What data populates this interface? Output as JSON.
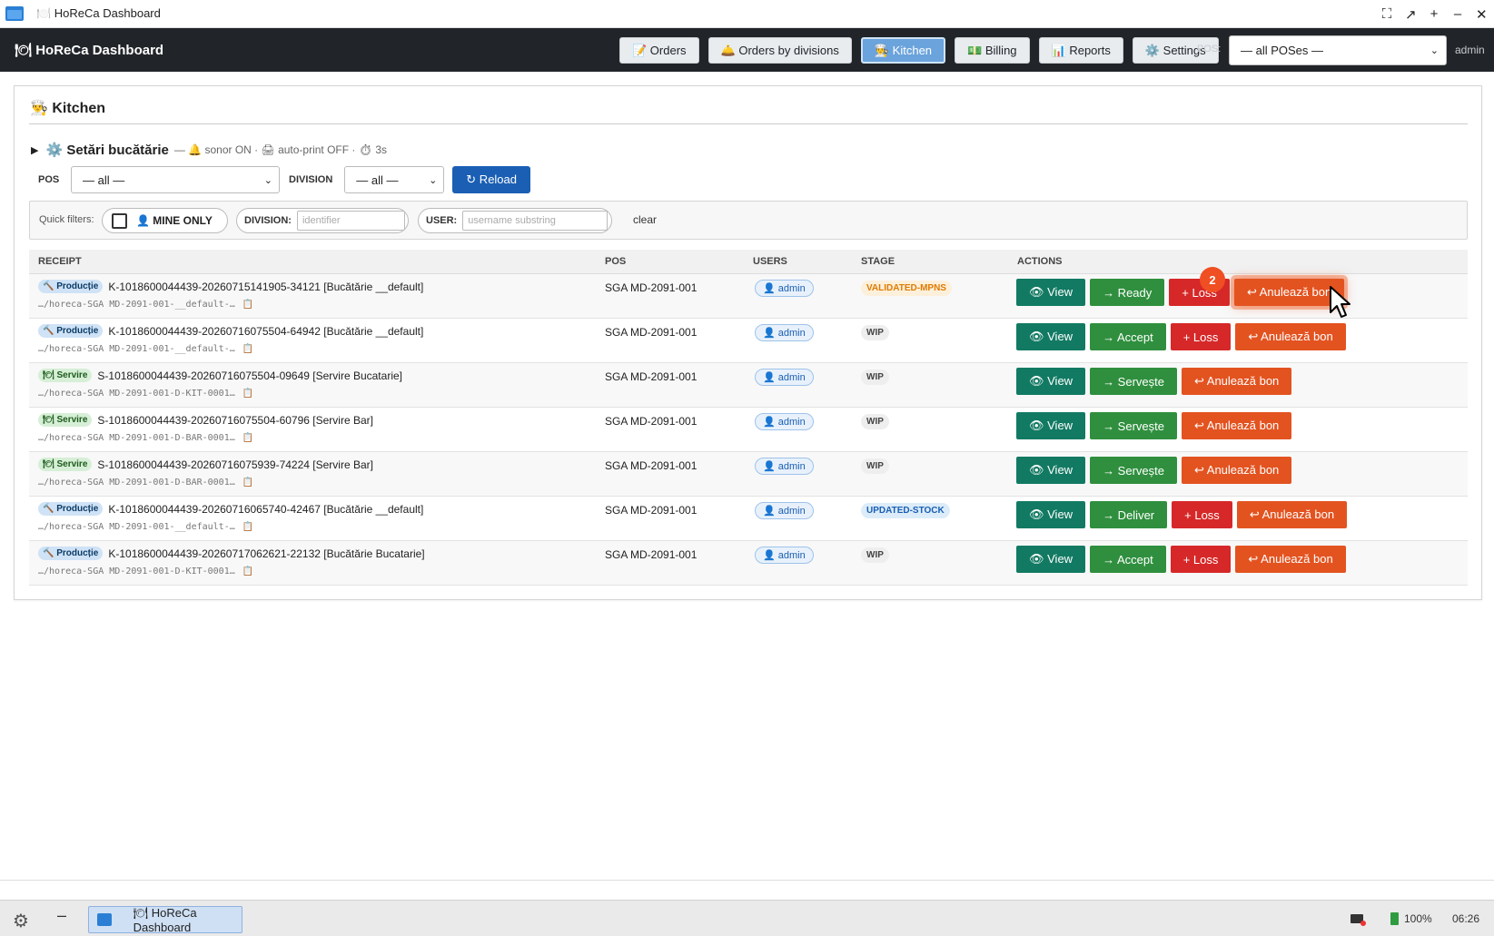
{
  "window": {
    "title": "HoReCa Dashboard",
    "title_icon": "🍽️"
  },
  "appbar": {
    "brand": "🍽 HoReCa Dashboard",
    "nav": [
      {
        "label": "📝 Orders",
        "icon": "memo-icon"
      },
      {
        "label": "🛎️ Orders by divisions",
        "icon": "bell-icon"
      },
      {
        "label": "👨‍🍳 Kitchen",
        "icon": "chef-icon",
        "active": true
      },
      {
        "label": "💵 Billing",
        "icon": "money-icon"
      },
      {
        "label": "📊 Reports",
        "icon": "chart-icon"
      },
      {
        "label": "⚙️ Settings",
        "icon": "gear-icon"
      }
    ],
    "pos_label": "POS:",
    "pos_value": "— all POSes —",
    "user": "admin"
  },
  "kitchen": {
    "title": "👨‍🍳 Kitchen",
    "settings": {
      "title": "⚙️ Setări bucătărie",
      "status": "— 🔔 sonor ON · 🖨 auto-print OFF · ⏱ 3s"
    },
    "filters": {
      "pos_label": "POS",
      "pos_value": "— all —",
      "division_label": "DIVISION",
      "division_value": "— all —",
      "reload_label": "↻ Reload"
    },
    "quick": {
      "label": "Quick filters:",
      "mine_only": "👤 MINE ONLY",
      "division_label": "DIVISION:",
      "division_placeholder": "identifier",
      "user_label": "USER:",
      "user_placeholder": "username substring",
      "clear": "clear"
    },
    "columns": [
      "RECEIPT",
      "POS",
      "USERS",
      "STAGE",
      "ACTIONS"
    ],
    "rows": [
      {
        "badge": "🔨 Producție",
        "badge_type": "prod",
        "receipt": "K-1018600044439-20260715141905-34121 [Bucătărie __default]",
        "path": "…/horeca-SGA MD-2091-001-__default-…",
        "pos": "SGA MD-2091-001",
        "user": "👤 admin",
        "stage": "VALIDATED-MPNS",
        "stage_type": "val",
        "next": "→ Ready",
        "loss": "+ Loss",
        "cancel": "↩ Anulează bon",
        "view": "👁 View"
      },
      {
        "badge": "🔨 Producție",
        "badge_type": "prod",
        "receipt": "K-1018600044439-20260716075504-64942 [Bucătărie __default]",
        "path": "…/horeca-SGA MD-2091-001-__default-…",
        "pos": "SGA MD-2091-001",
        "user": "👤 admin",
        "stage": "WIP",
        "stage_type": "wip",
        "next": "→ Accept",
        "loss": "+ Loss",
        "cancel": "↩ Anulează bon",
        "view": "👁 View"
      },
      {
        "badge": "🍽 Servire",
        "badge_type": "serv",
        "receipt": "S-1018600044439-20260716075504-09649 [Servire Bucatarie]",
        "path": "…/horeca-SGA MD-2091-001-D-KIT-0001…",
        "pos": "SGA MD-2091-001",
        "user": "👤 admin",
        "stage": "WIP",
        "stage_type": "wip",
        "next": "→ Servește",
        "loss": "",
        "cancel": "↩ Anulează bon",
        "view": "👁 View"
      },
      {
        "badge": "🍽 Servire",
        "badge_type": "serv",
        "receipt": "S-1018600044439-20260716075504-60796 [Servire Bar]",
        "path": "…/horeca-SGA MD-2091-001-D-BAR-0001…",
        "pos": "SGA MD-2091-001",
        "user": "👤 admin",
        "stage": "WIP",
        "stage_type": "wip",
        "next": "→ Servește",
        "loss": "",
        "cancel": "↩ Anulează bon",
        "view": "👁 View"
      },
      {
        "badge": "🍽 Servire",
        "badge_type": "serv",
        "receipt": "S-1018600044439-20260716075939-74224 [Servire Bar]",
        "path": "…/horeca-SGA MD-2091-001-D-BAR-0001…",
        "pos": "SGA MD-2091-001",
        "user": "👤 admin",
        "stage": "WIP",
        "stage_type": "wip",
        "next": "→ Servește",
        "loss": "",
        "cancel": "↩ Anulează bon",
        "view": "👁 View"
      },
      {
        "badge": "🔨 Producție",
        "badge_type": "prod",
        "receipt": "K-1018600044439-20260716065740-42467 [Bucătărie __default]",
        "path": "…/horeca-SGA MD-2091-001-__default-…",
        "pos": "SGA MD-2091-001",
        "user": "👤 admin",
        "stage": "UPDATED-STOCK",
        "stage_type": "upd",
        "next": "→ Deliver",
        "loss": "+ Loss",
        "cancel": "↩ Anulează bon",
        "view": "👁 View"
      },
      {
        "badge": "🔨 Producție",
        "badge_type": "prod",
        "receipt": "K-1018600044439-20260717062621-22132 [Bucătărie Bucatarie]",
        "path": "…/horeca-SGA MD-2091-001-D-KIT-0001…",
        "pos": "SGA MD-2091-001",
        "user": "👤 admin",
        "stage": "WIP",
        "stage_type": "wip",
        "next": "→ Accept",
        "loss": "+ Loss",
        "cancel": "↩ Anulează bon",
        "view": "👁 View"
      }
    ],
    "copy_icon": "📋",
    "step_badge": "2"
  },
  "taskbar": {
    "task_label": "🍽 HoReCa Dashboard",
    "battery": "100%",
    "clock": "06:26"
  },
  "colors": {
    "appbar_bg": "#212529",
    "view_button": "#127a63",
    "action_button": "#2f8f3e",
    "loss_button": "#d62828",
    "cancel_button": "#e35320",
    "reload_button": "#1a5fb4"
  }
}
